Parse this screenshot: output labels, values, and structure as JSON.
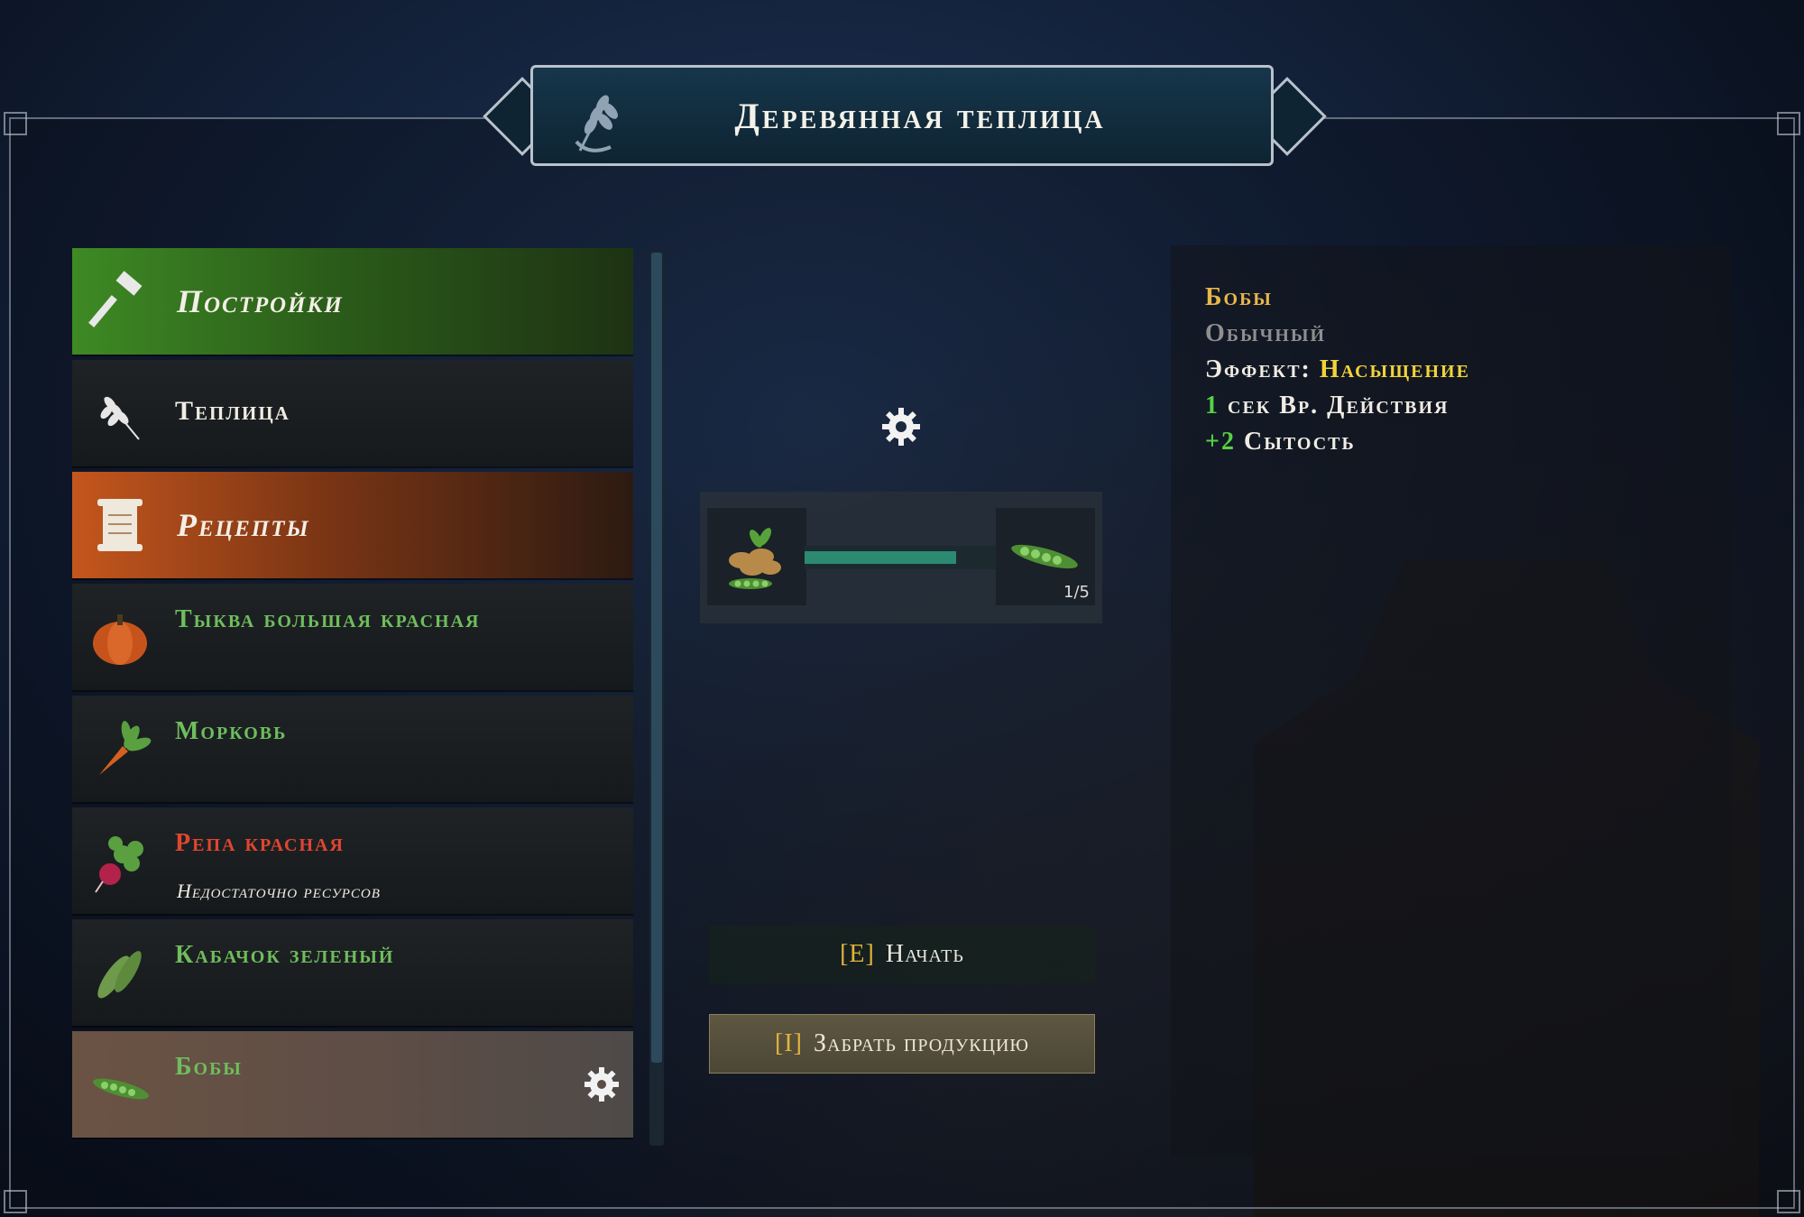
{
  "title": "Деревянная теплица",
  "menu": {
    "category_buildings": "Постройки",
    "building_greenhouse": "Теплица",
    "category_recipes": "Рецепты",
    "recipes": [
      {
        "name": "Тыква большая красная",
        "status": ""
      },
      {
        "name": "Морковь",
        "status": ""
      },
      {
        "name": "Репа красная",
        "status": "Недостаточно ресурсов"
      },
      {
        "name": "Кабачок зеленый",
        "status": ""
      },
      {
        "name": "Бобы",
        "status": ""
      }
    ],
    "selected_recipe": "Бобы"
  },
  "crafting": {
    "progress": 0.78,
    "output_count": "1/5"
  },
  "actions": {
    "start_key": "[E]",
    "start_label": "Начать",
    "collect_key": "[I]",
    "collect_label": "Забрать продукцию"
  },
  "info": {
    "name": "Бобы",
    "rarity": "Обычный",
    "effect_label": "Эффект:",
    "effect_value": "Насыщение",
    "duration_value": "1",
    "duration_label": "сек Вр. Действия",
    "satiety_value": "+2",
    "satiety_label": "Сытость"
  },
  "colors": {
    "green_accent": "#3e8a24",
    "orange_accent": "#c4561d",
    "progress": "#2d8a72",
    "item_green": "#6fbd5c",
    "item_red": "#e0462f",
    "key_gold": "#e2b43c"
  },
  "icons": [
    "wheat-icon",
    "hammer-icon",
    "scroll-icon",
    "pumpkin-icon",
    "carrot-icon",
    "radish-icon",
    "zucchini-icon",
    "peas-icon",
    "gear-icon",
    "seeds-icon"
  ]
}
